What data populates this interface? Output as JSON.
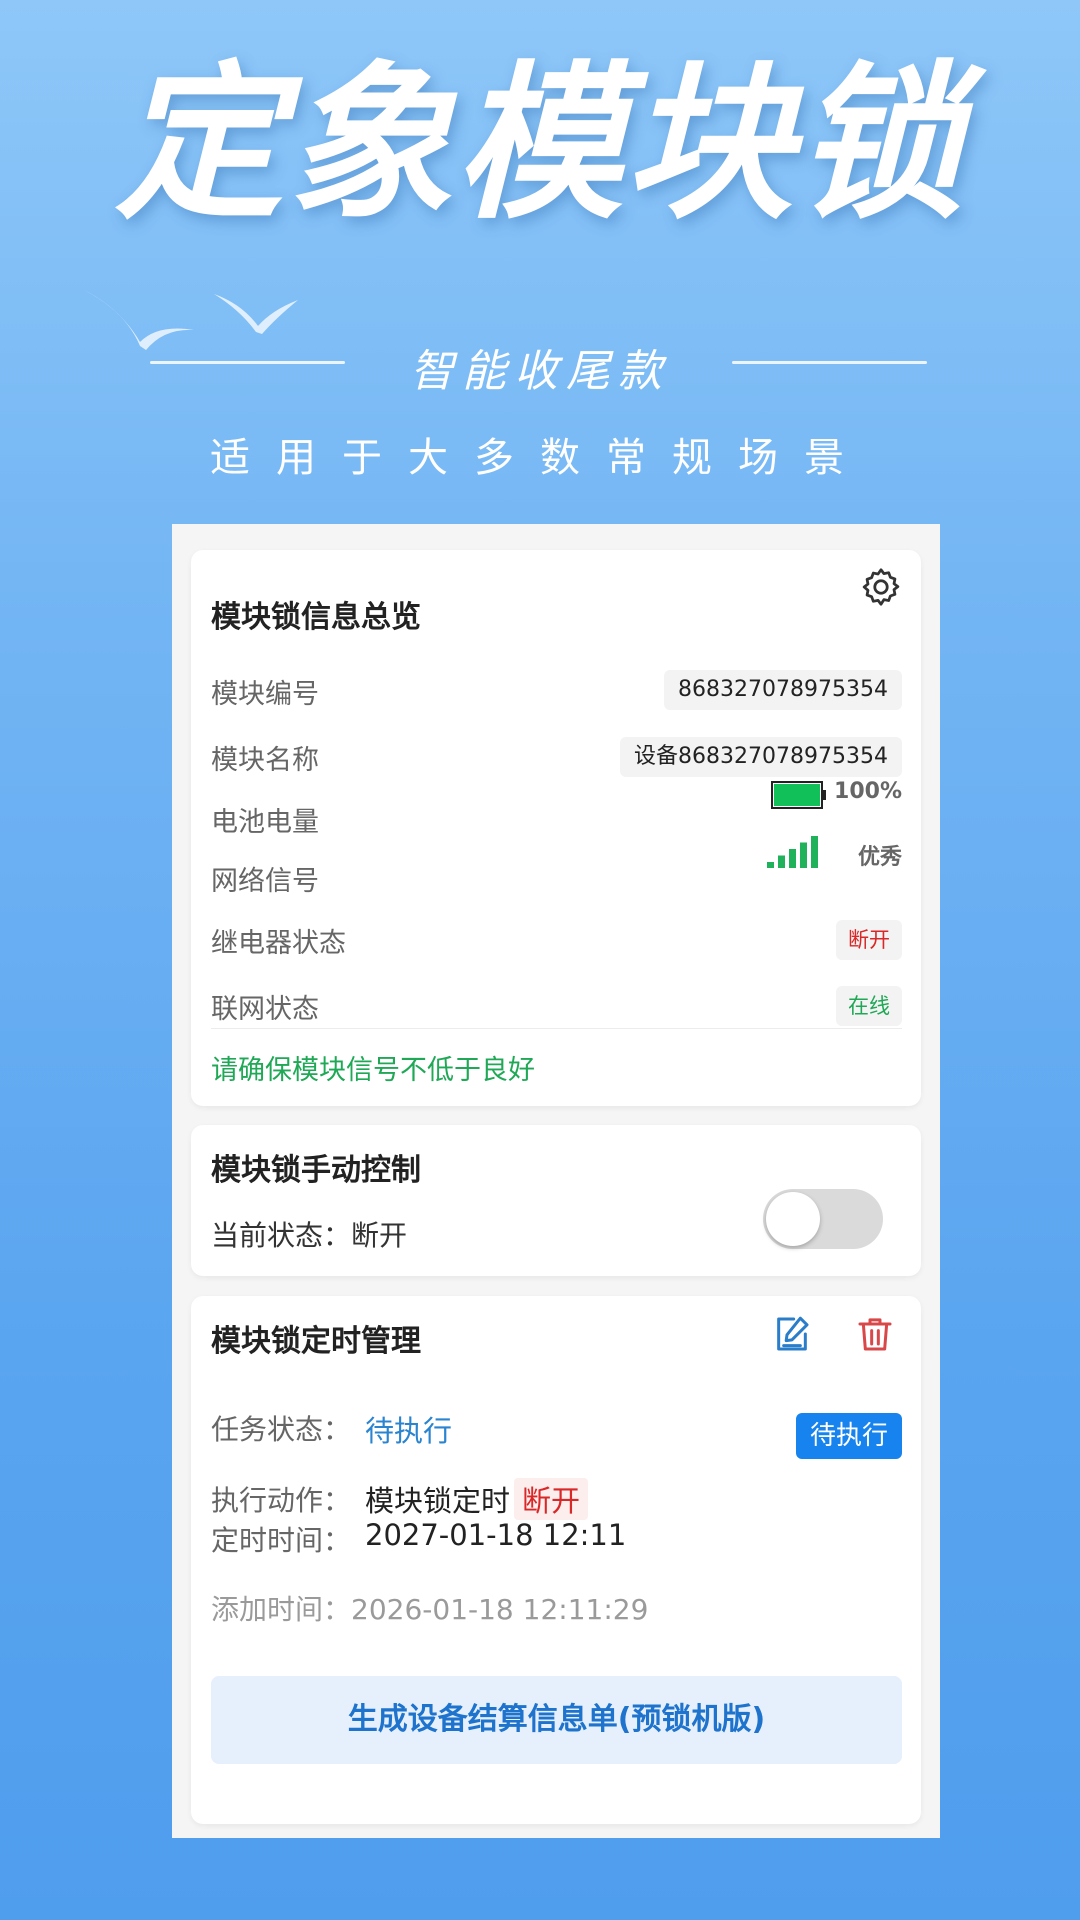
{
  "hero": {
    "title": "定象模块锁",
    "subtitle": "智能收尾款",
    "scene": "适用于大多数常规场景"
  },
  "overview": {
    "title": "模块锁信息总览",
    "module_no_label": "模块编号",
    "module_no": "868327078975354",
    "module_name_label": "模块名称",
    "module_name": "设备868327078975354",
    "battery_label": "电池电量",
    "battery_value": "100%",
    "battery_level": 1.0,
    "signal_label": "网络信号",
    "signal_value": "优秀",
    "signal_bars": 5,
    "relay_label": "继电器状态",
    "relay_value": "断开",
    "network_label": "联网状态",
    "network_value": "在线",
    "notice": "请确保模块信号不低于良好"
  },
  "manual": {
    "title": "模块锁手动控制",
    "state_label": "当前状态：",
    "state_value": "断开",
    "toggle_on": false
  },
  "timer": {
    "title": "模块锁定时管理",
    "task_status_label": "任务状态：",
    "task_status_value": "待执行",
    "task_badge": "待执行",
    "action_label": "执行动作：",
    "action_value": "模块锁定时",
    "action_state": "断开",
    "time_label": "定时时间：",
    "time_value": "2027-01-18 12:11",
    "added_label": "添加时间：",
    "added_value": "2026-01-18 12:11:29",
    "bill_button": "生成设备结算信息单(预锁机版)"
  },
  "colors": {
    "accent": "#1683ee",
    "success": "#1fa856",
    "danger": "#d82828",
    "battery": "#12c05a"
  },
  "icons": [
    "gear-icon",
    "battery-icon",
    "signal-icon",
    "edit-icon",
    "trash-icon",
    "bird-icon"
  ]
}
